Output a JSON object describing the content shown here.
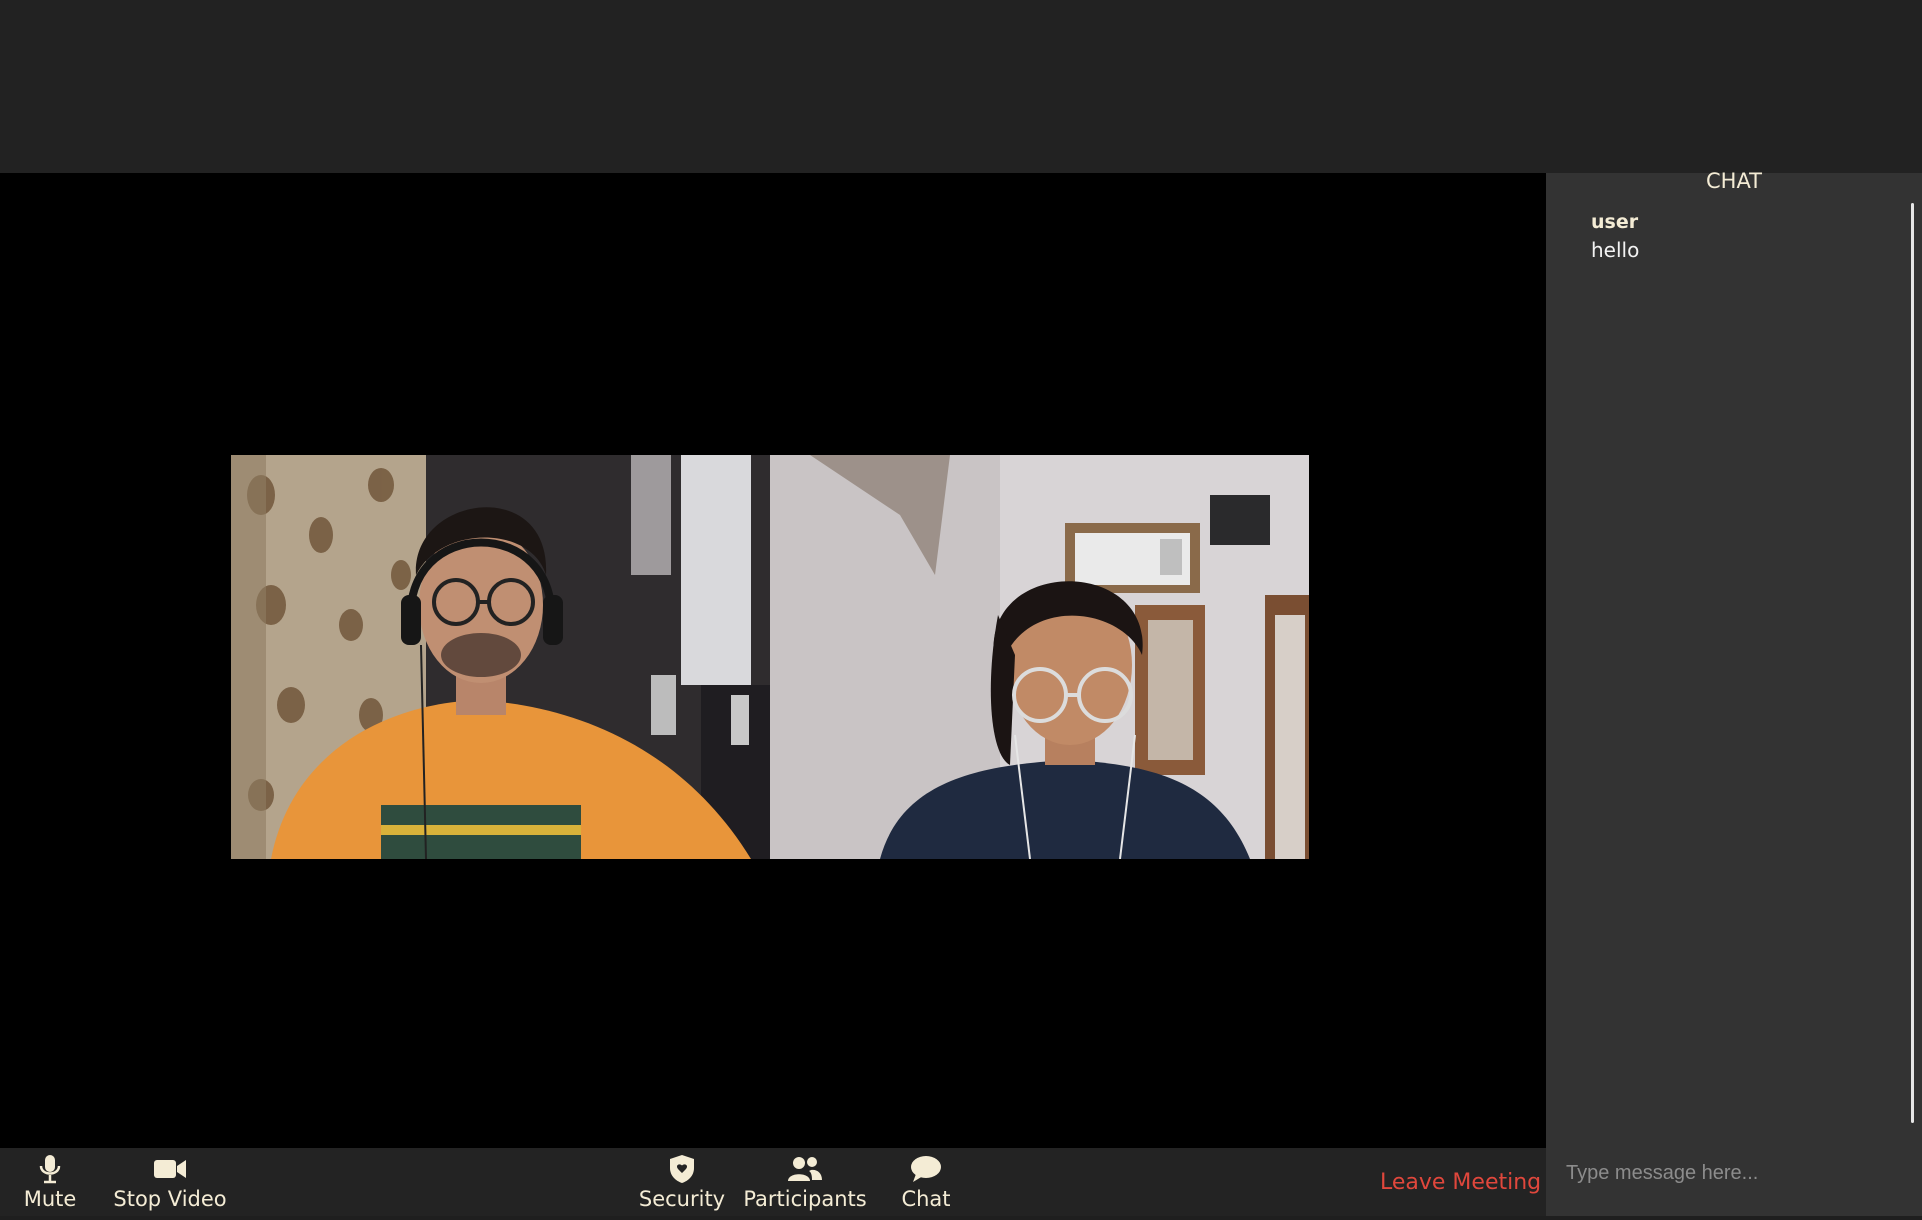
{
  "chat": {
    "title": "CHAT",
    "messages": [
      {
        "sender": "user",
        "text": "hello"
      }
    ],
    "input_placeholder": "Type message here..."
  },
  "toolbar": {
    "mute_label": "Mute",
    "stop_video_label": "Stop Video",
    "security_label": "Security",
    "participants_label": "Participants",
    "chat_label": "Chat",
    "leave_label": "Leave Meeting"
  },
  "icons": {
    "mute": "microphone-icon",
    "stop_video": "video-camera-icon",
    "security": "shield-icon",
    "participants": "people-icon",
    "chat": "speech-bubble-icon"
  },
  "colors": {
    "label": "#f4ecd5",
    "leave": "#e0473c",
    "stage": "#000000",
    "chat_bg": "#333333"
  }
}
